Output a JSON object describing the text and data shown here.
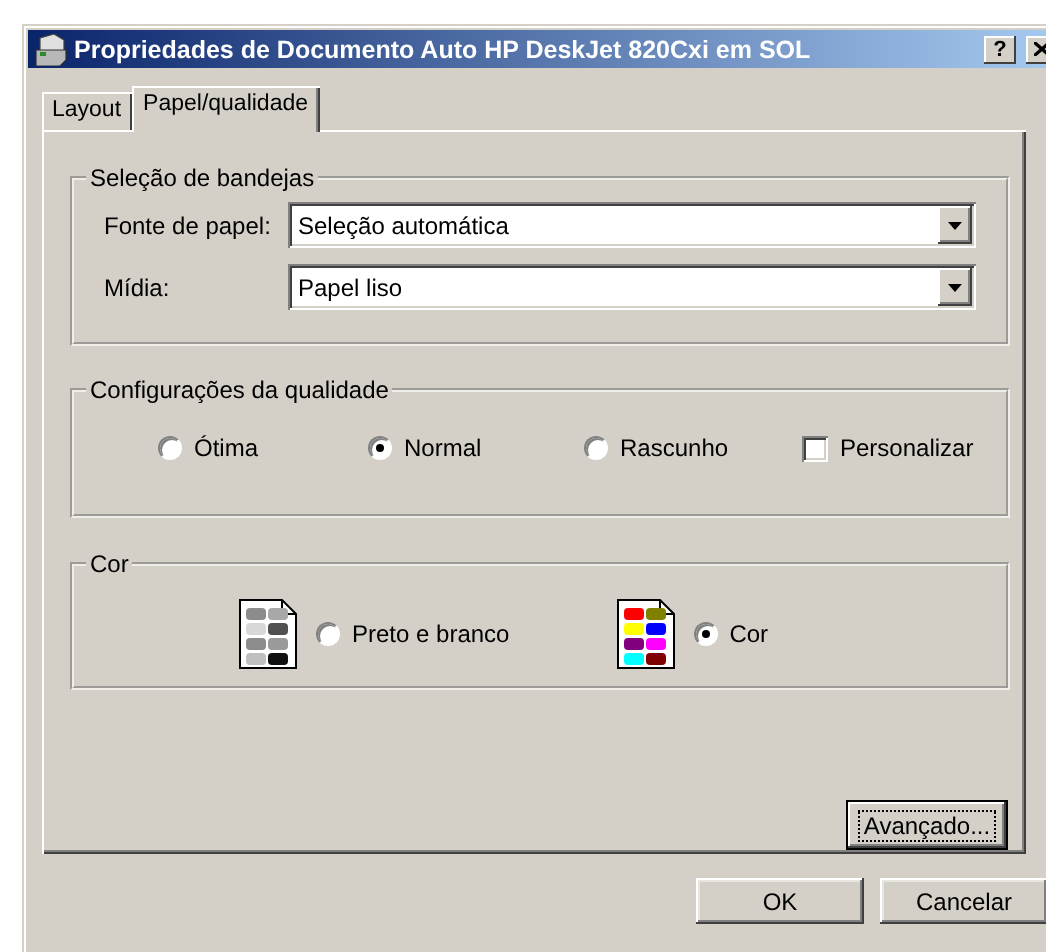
{
  "window": {
    "title": "Propriedades de Documento Auto HP DeskJet 820Cxi em SOL",
    "help_button": "?"
  },
  "tabs": [
    {
      "label": "Layout",
      "selected": false
    },
    {
      "label": "Papel/qualidade",
      "selected": true
    }
  ],
  "tray_selection": {
    "title": "Seleção de bandejas",
    "fields": [
      {
        "label": "Fonte de papel:",
        "value": "Seleção automática"
      },
      {
        "label": "Mídia:",
        "value": "Papel liso"
      }
    ]
  },
  "quality": {
    "title": "Configurações da qualidade",
    "options": [
      {
        "kind": "radio",
        "label": "Ótima",
        "selected": false
      },
      {
        "kind": "radio",
        "label": "Normal",
        "selected": true
      },
      {
        "kind": "radio",
        "label": "Rascunho",
        "selected": false
      },
      {
        "kind": "checkbox",
        "label": "Personalizar",
        "checked": false
      }
    ]
  },
  "color": {
    "title": "Cor",
    "options": [
      {
        "kind": "grayscale",
        "label": "Preto e branco",
        "selected": false
      },
      {
        "kind": "color",
        "label": "Cor",
        "selected": true
      }
    ]
  },
  "advanced_button": "Avançado...",
  "buttons": [
    "OK",
    "Cancelar"
  ]
}
